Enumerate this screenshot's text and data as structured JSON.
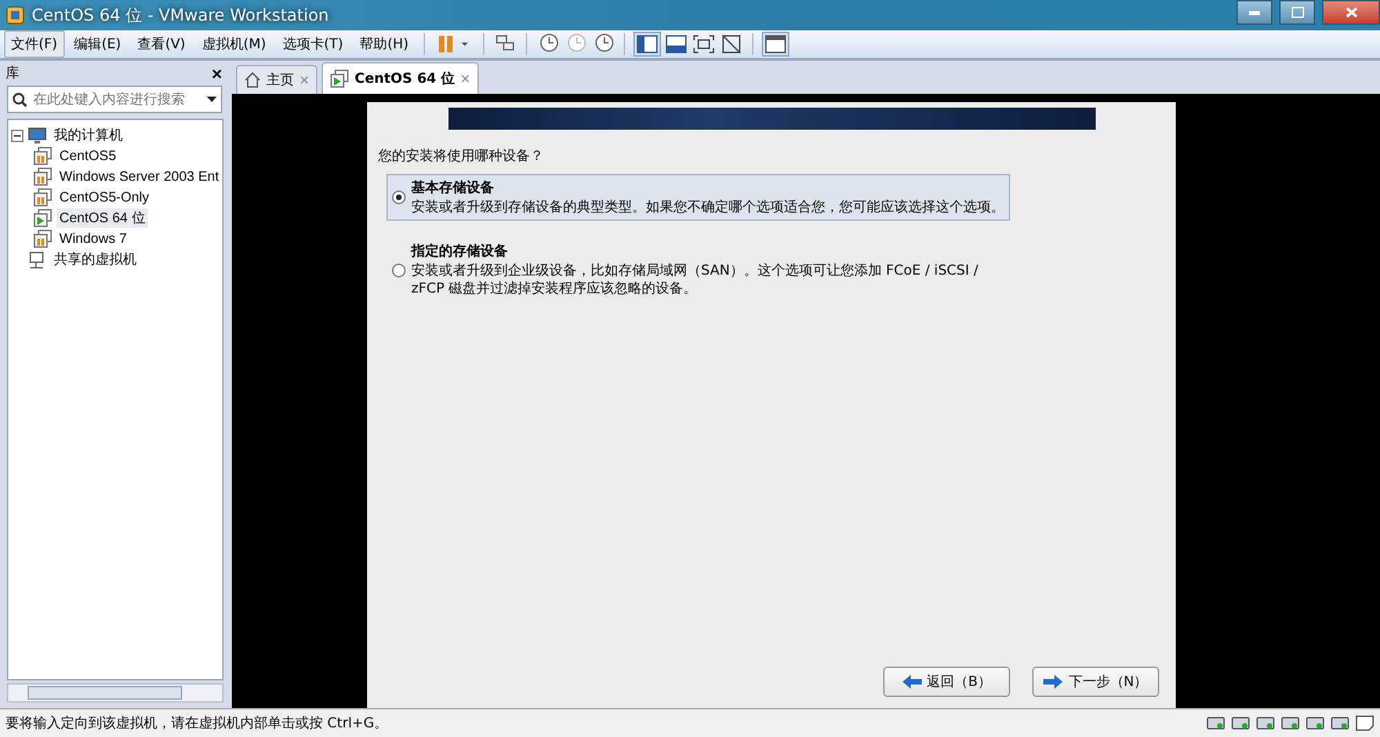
{
  "window": {
    "title": "CentOS 64 位 - VMware Workstation"
  },
  "menu": [
    {
      "label": "文件(F)",
      "selected": true
    },
    {
      "label": "编辑(E)",
      "selected": false
    },
    {
      "label": "查看(V)",
      "selected": false
    },
    {
      "label": "虚拟机(M)",
      "selected": false
    },
    {
      "label": "选项卡(T)",
      "selected": false
    },
    {
      "label": "帮助(H)",
      "selected": false
    }
  ],
  "library": {
    "title": "库",
    "close": "×",
    "search": {
      "placeholder": "在此处键入内容进行搜索"
    },
    "tree": [
      {
        "label": "我的计算机",
        "kind": "computer",
        "expanded": true,
        "children": [
          {
            "label": "CentOS5",
            "running": false,
            "selected": false
          },
          {
            "label": "Windows Server 2003 Ent",
            "running": false,
            "selected": false
          },
          {
            "label": "CentOS5-Only",
            "running": false,
            "selected": false
          },
          {
            "label": "CentOS 64 位",
            "running": true,
            "selected": true
          },
          {
            "label": "Windows 7",
            "running": false,
            "selected": false
          }
        ]
      },
      {
        "label": "共享的虚拟机",
        "kind": "shared"
      }
    ]
  },
  "tabs": [
    {
      "label": "主页",
      "kind": "home",
      "selected": false,
      "close": "×"
    },
    {
      "label": "CentOS 64 位",
      "kind": "vm",
      "selected": true,
      "close": "×"
    }
  ],
  "installer": {
    "question": "您的安装将使用哪种设备？",
    "options": [
      {
        "title": "基本存储设备",
        "description": "安装或者升级到存储设备的典型类型。如果您不确定哪个选项适合您，您可能应该选择这个选项。",
        "selected": true
      },
      {
        "title": "指定的存储设备",
        "description": "安装或者升级到企业级设备，比如存储局域网（SAN）。这个选项可让您添加 FCoE / iSCSI / zFCP 磁盘并过滤掉安装程序应该忽略的设备。",
        "selected": false
      }
    ],
    "buttons": [
      {
        "label": "返回（B）",
        "kind": "back"
      },
      {
        "label": "下一步（N）",
        "kind": "next"
      }
    ]
  },
  "status_bar": {
    "message": "要将输入定向到该虚拟机，请在虚拟机内部单击或按 Ctrl+G。"
  }
}
